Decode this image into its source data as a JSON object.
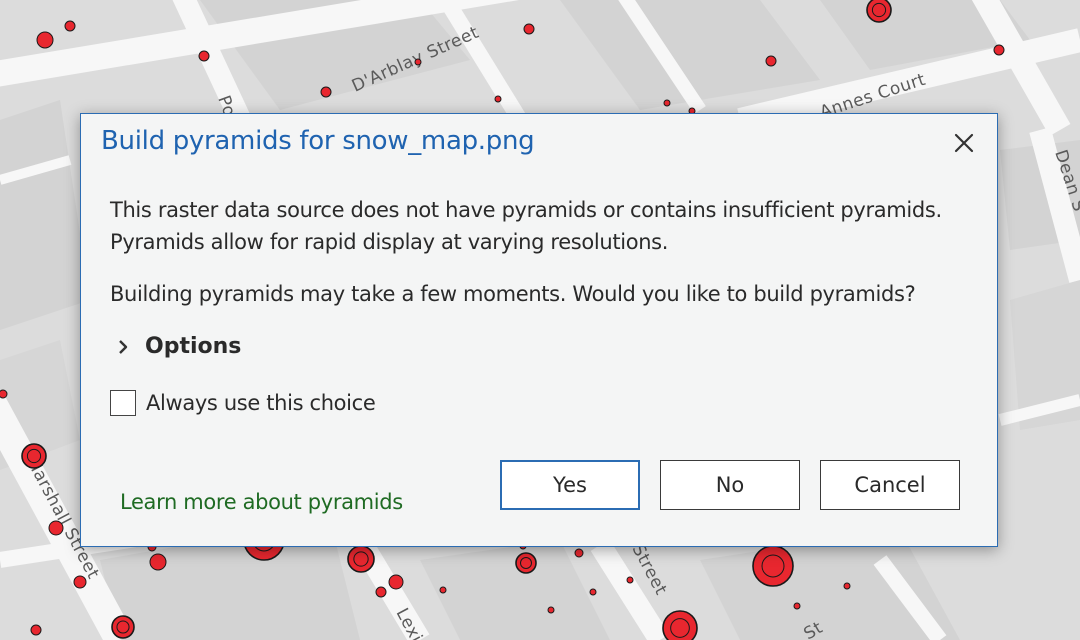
{
  "map": {
    "street_labels": {
      "darblay": "D'Arblay Street",
      "annes": "Annes Court",
      "dean": "Dean S",
      "marshall": "Marshall Street",
      "street_bottom": "Street",
      "lexi": "Lexi",
      "po": "Po",
      "st": "St"
    },
    "colors": {
      "background": "#e1e1e1",
      "road": "#f7f7f7",
      "block": "#d6d6d6",
      "point_fill": "#e8272f",
      "point_stroke": "#1a1a1a"
    }
  },
  "dialog": {
    "title": "Build pyramids for snow_map.png",
    "close_icon": "close-icon",
    "message_line1": "This raster data source does not have pyramids or contains insufficient pyramids. Pyramids allow for rapid display at varying resolutions.",
    "message_line2": "Building pyramids may take a few moments. Would you like to build pyramids?",
    "options_label": "Options",
    "always_label": "Always use this choice",
    "always_checked": false,
    "learn_more": "Learn more about pyramids",
    "buttons": {
      "yes": "Yes",
      "no": "No",
      "cancel": "Cancel"
    },
    "colors": {
      "title": "#1f63b0",
      "border": "#2b6cb3",
      "link": "#1f6b23",
      "background": "#f4f5f5"
    }
  }
}
